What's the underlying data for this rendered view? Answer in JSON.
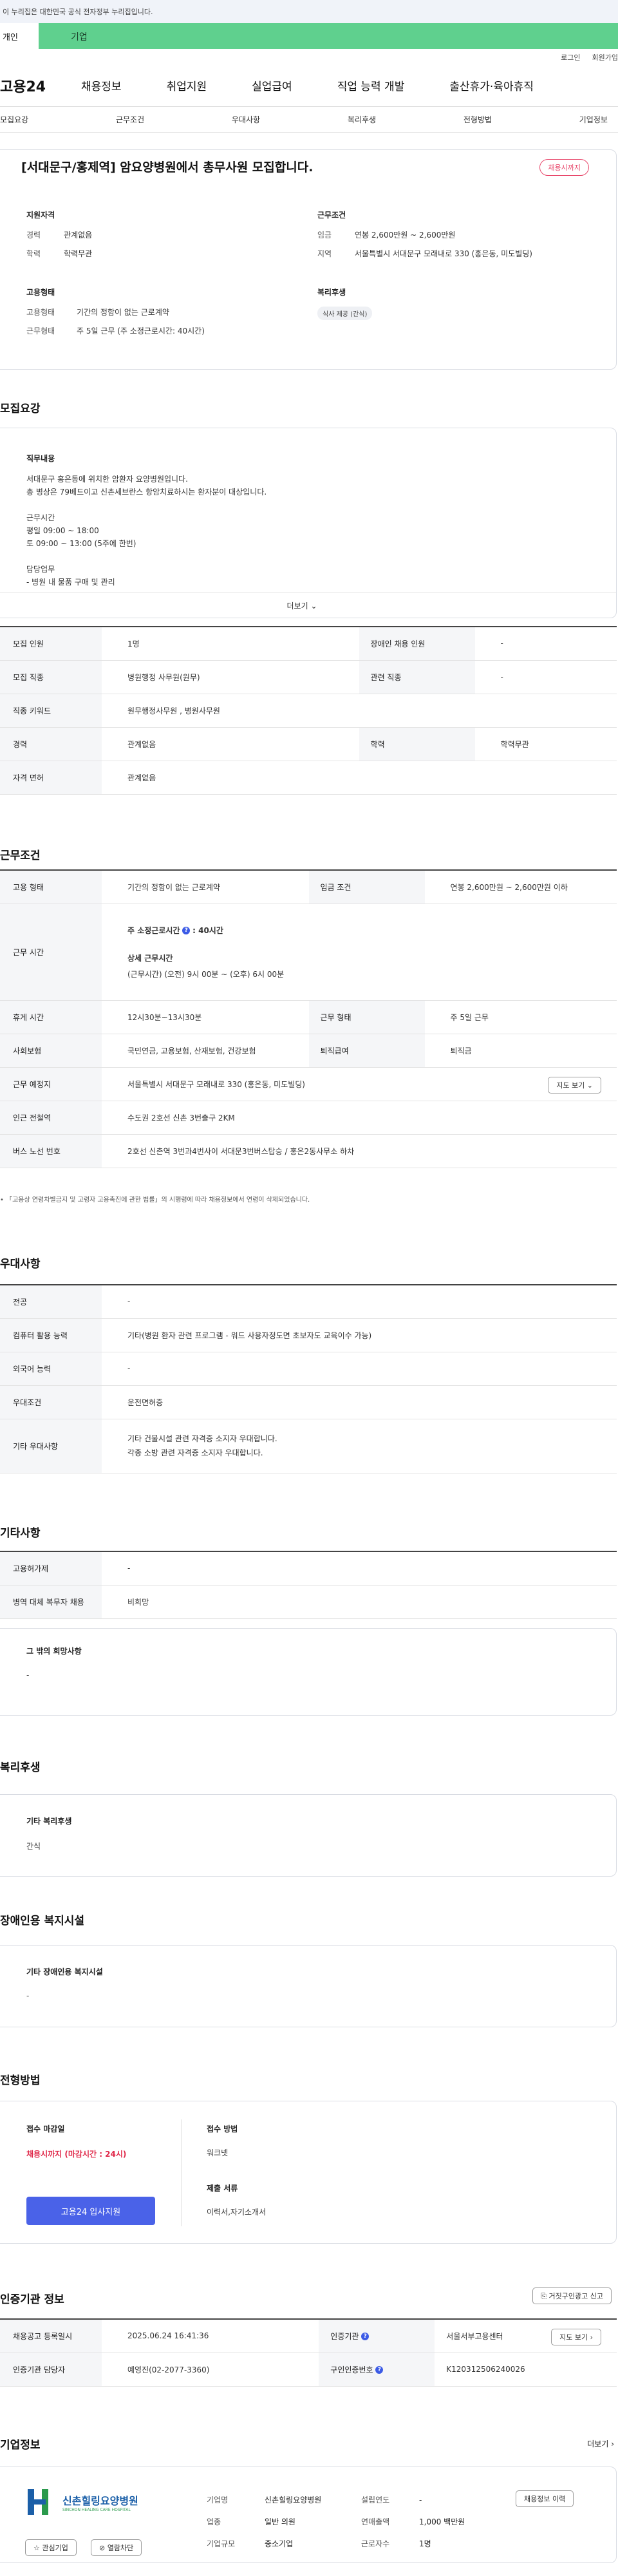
{
  "topbar": {
    "notice": "이 누리집은 대한민국 공식 전자정부 누리집입니다."
  },
  "user_tabs": {
    "individual": "개인",
    "business": "기업"
  },
  "util": {
    "login": "로그인",
    "join": "회원가입"
  },
  "logo": "고용24",
  "gnb": [
    "채용정보",
    "취업지원",
    "실업급여",
    "직업 능력 개발",
    "출산휴가·육아휴직"
  ],
  "subnav": [
    "모집요강",
    "근무조건",
    "우대사항",
    "복리후생",
    "전형방법",
    "기업정보"
  ],
  "header": {
    "title": "[서대문구/홍제역] 암요양병원에서 총무사원 모집합니다.",
    "badge": "채용시까지",
    "qual_head": "지원자격",
    "career_k": "경력",
    "career_v": "관계없음",
    "edu_k": "학력",
    "edu_v": "학력무관",
    "work_head": "근무조건",
    "wage_k": "임금",
    "wage_v": "연봉 2,600만원 ~ 2,600만원",
    "region_k": "지역",
    "region_v": "서울특별시 서대문구 모래내로 330 (홍은동, 미도빌딩)",
    "emp_head": "고용형태",
    "emptype_k": "고용형태",
    "emptype_v": "기간의 정함이 없는 근로계약",
    "workform_k": "근무형태",
    "workform_v": "주 5일 근무 (주 소정근로시간: 40시간)",
    "welfare_head": "복리후생",
    "welfare_chip": "식사 제공 (간식)"
  },
  "recruit": {
    "section_title": "모집요강",
    "job_label": "직무내용",
    "job_text": "서대문구 홍은동에 위치한 암환자 요양병원입니다.\n총 병상은 79베드이고 신촌세브란스 항암치료하시는 환자분이 대상입니다.\n\n근무시간\n평일 09:00 ~ 18:00\n토 09:00 ~ 13:00 (5주에 한번)\n\n담당업무\n- 병원 내 물품 구매 및 관리",
    "more": "더보기",
    "rows": [
      {
        "k1": "모집 인원",
        "v1": "1명",
        "k2": "장애인 채용 인원",
        "v2": "-"
      },
      {
        "k1": "모집 직종",
        "v1": "병원행정 사무원(원무)",
        "k2": "관련 직종",
        "v2": "-"
      },
      {
        "k1": "직종 키워드",
        "v1": "원무행정사무원 , 병원사무원"
      },
      {
        "k1": "경력",
        "v1": "관계없음",
        "k2": "학력",
        "v2": "학력무관"
      },
      {
        "k1": "자격 면허",
        "v1": "관계없음"
      }
    ]
  },
  "conditions": {
    "section_title": "근무조건",
    "emptype_k": "고용 형태",
    "emptype_v": "기간의 정함이 없는 근로계약",
    "wage_k": "임금 조건",
    "wage_v": "연봉 2,600만원 ~ 2,600만원 이하",
    "hours_k": "근무 시간",
    "hours_weekly": "주 소정근로시간",
    "hours_weekly_val": ": 40시간",
    "hours_detail_label": "상세 근무시간",
    "hours_detail": "(근무시간) (오전) 9시 00분 ~ (오후) 6시 00분",
    "rest_k": "휴게 시간",
    "rest_v": "12시30분~13시30분",
    "form_k": "근무 형태",
    "form_v": "주 5일 근무",
    "insur_k": "사회보험",
    "insur_v": "국민연금, 고용보험, 산재보험, 건강보험",
    "retire_k": "퇴직급여",
    "retire_v": "퇴직금",
    "place_k": "근무 예정지",
    "place_v": "서울특별시 서대문구 모래내로 330 (홍은동, 미도빌딩)",
    "map_btn": "지도 보기",
    "subway_k": "인근 전철역",
    "subway_v": "수도권 2호선 신촌 3번출구 2KM",
    "bus_k": "버스 노선 번호",
    "bus_v": "2호선 신촌역 3번과4번사이 서대문3번버스탑승 / 홍은2동사무소 하차",
    "note": "「고용상 연령차별금지 및 고령자 고용촉진에 관한 법률」의 시행령에 따라 채용정보에서 연령이 삭제되었습니다."
  },
  "preference": {
    "section_title": "우대사항",
    "rows": [
      {
        "k": "전공",
        "v": "-"
      },
      {
        "k": "컴퓨터 활용 능력",
        "v": "기타(병원 환자 관련 프로그램 - 워드 사용자정도면 초보자도 교육이수 가능)"
      },
      {
        "k": "외국어 능력",
        "v": "-"
      },
      {
        "k": "우대조건",
        "v": "운전면허증"
      },
      {
        "k": "기타 우대사항",
        "v": "기타 건물시설 관련 자격증 소지자 우대합니다.\n각종 소방 관련 자격증 소지자 우대합니다."
      }
    ]
  },
  "etc": {
    "section_title": "기타사항",
    "rows": [
      {
        "k": "고용허가제",
        "v": "-"
      },
      {
        "k": "병역 대체 복무자 채용",
        "v": "비희망"
      }
    ],
    "other_label": "그 밖의 희망사항",
    "other_val": "-"
  },
  "welfare": {
    "section_title": "복리후생",
    "label": "기타 복리후생",
    "val": "간식"
  },
  "disability": {
    "section_title": "장애인용 복지시설",
    "label": "기타 장애인용 복지시설",
    "val": "-"
  },
  "selection": {
    "section_title": "전형방법",
    "deadline_label": "접수 마감일",
    "deadline_val": "채용시까지 (마감시간 : 24시)",
    "apply_btn": "고용24 입사지원",
    "method_label": "접수 방법",
    "method_val": "워크넷",
    "docs_label": "제출 서류",
    "docs_val": "이력서,자기소개서"
  },
  "agency": {
    "section_title": "인증기관 정보",
    "report_btn": "거짓구인광고 신고",
    "reg_k": "채용공고 등록일시",
    "reg_v": "2025.06.24 16:41:36",
    "org_k": "인증기관",
    "org_v": "서울서부고용센터",
    "map_btn": "지도 보기",
    "person_k": "인증기관 담당자",
    "person_v": "예영진(02-2077-3360)",
    "num_k": "구인인증번호",
    "num_v": "K120312506240026"
  },
  "company": {
    "section_title": "기업정보",
    "more": "더보기",
    "logo_name": "신촌힐링요양병원",
    "logo_sub": "SINCHON HEALING CARE HOSPITAL",
    "fav_btn": "관심기업",
    "block_btn": "열람차단",
    "name_k": "기업명",
    "name_v": "신촌힐링요양병원",
    "industry_k": "업종",
    "industry_v": "일반 의원",
    "size_k": "기업규모",
    "size_v": "중소기업",
    "year_k": "설립연도",
    "year_v": "-",
    "sales_k": "연매출액",
    "sales_v": "1,000 백만원",
    "staff_k": "근로자수",
    "staff_v": "1명",
    "jobs_btn": "채용정보 이력"
  }
}
